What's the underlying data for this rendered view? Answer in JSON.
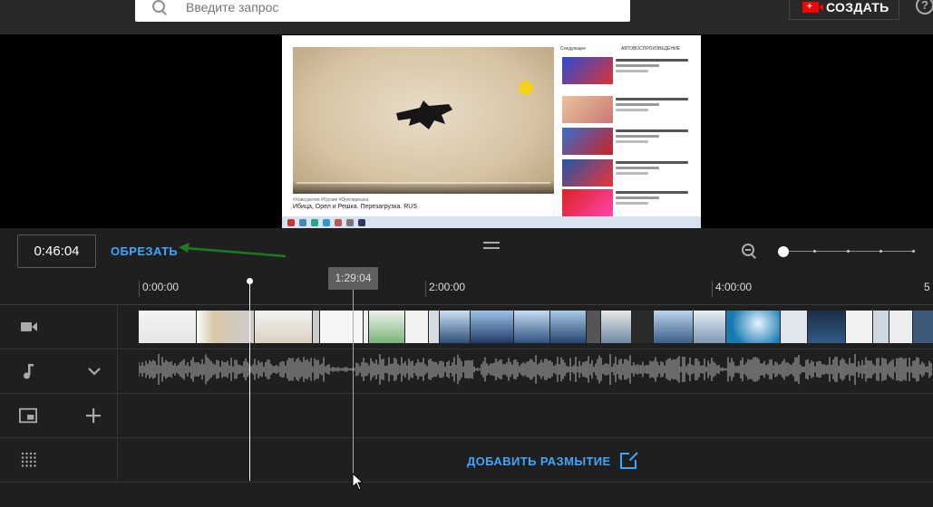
{
  "header": {
    "search_placeholder": "Введите запрос",
    "create_label": "СОЗДАТЬ",
    "help_label": "?"
  },
  "preview": {
    "sidebar_header": "Следующее",
    "autoplay_label": "АВТОВОСПРОИЗВЕДЕНИЕ",
    "caption_small": "#Хевсуретия #Грузия #Орёлирешка",
    "caption_title": "Ибица, Орел и Решка. Перезагрузка. RUS"
  },
  "editor": {
    "current_time": "0:46:04",
    "trim_label": "ОБРЕЗАТЬ",
    "hover_time": "1:29:04",
    "ruler_ticks": [
      "0:00:00",
      "2:00:00",
      "4:00:00",
      "5"
    ],
    "add_blur_label": "ДОБАВИТЬ РАЗМЫТИЕ"
  },
  "colors": {
    "accent": "#3ea6ff",
    "brand_red": "#ff0000",
    "background": "#1f1f1f",
    "annotation_arrow": "#1e7a1e"
  },
  "icons": {
    "video_track": "video-camera-icon",
    "audio_track": "music-note-icon",
    "endscreen_track": "end-screen-icon",
    "blur_track": "blur-grid-icon",
    "zoom": "zoom-out-icon",
    "add": "plus-icon",
    "expand": "chevron-down-icon",
    "external": "open-external-icon"
  }
}
